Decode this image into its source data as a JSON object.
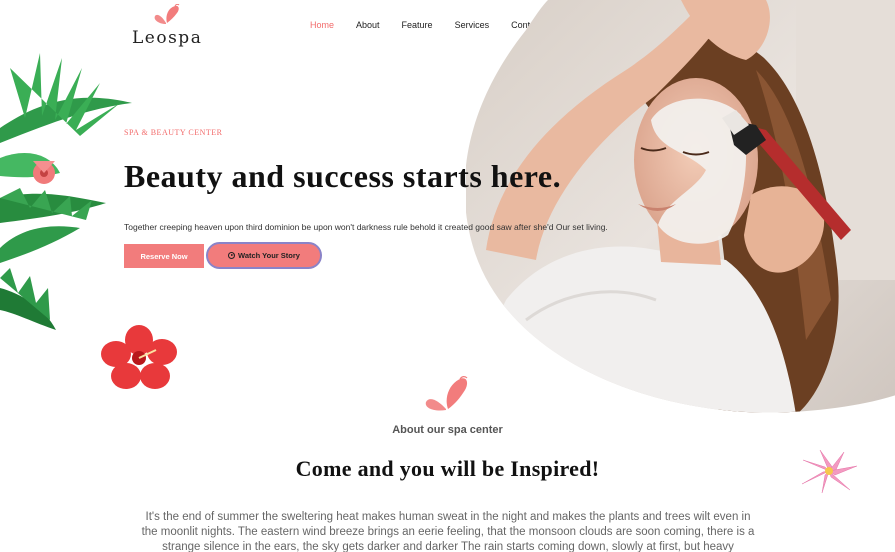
{
  "brand": {
    "name": "Leospa",
    "accent": "#f26b6b"
  },
  "nav": {
    "items": [
      {
        "label": "Home",
        "active": true
      },
      {
        "label": "About"
      },
      {
        "label": "Feature"
      },
      {
        "label": "Services"
      },
      {
        "label": "Contact"
      }
    ]
  },
  "hero": {
    "kicker": "SPA & BEAUTY CENTER",
    "title": "Beauty and success starts here.",
    "description": "Together creeping heaven upon third dominion be upon won't darkness rule behold it created good saw after she'd Our set living.",
    "reserve_label": "Reserve Now",
    "watch_label": "Watch Your Story"
  },
  "about": {
    "subtitle": "About our spa center",
    "title": "Come and you will be Inspired!",
    "text": "It's the end of summer the sweltering heat makes human sweat in the night and makes the plants and trees wilt even in the moonlit nights. The eastern wind breeze brings an eerie feeling, that the monsoon clouds are soon coming, there is a strange silence in the ears, the sky gets darker and darker The rain starts coming down, slowly at first, but heavy"
  },
  "icons": [
    "butterfly-logo-icon",
    "play-circle-icon",
    "palm-leaves",
    "hibiscus-flower",
    "pink-flower"
  ]
}
